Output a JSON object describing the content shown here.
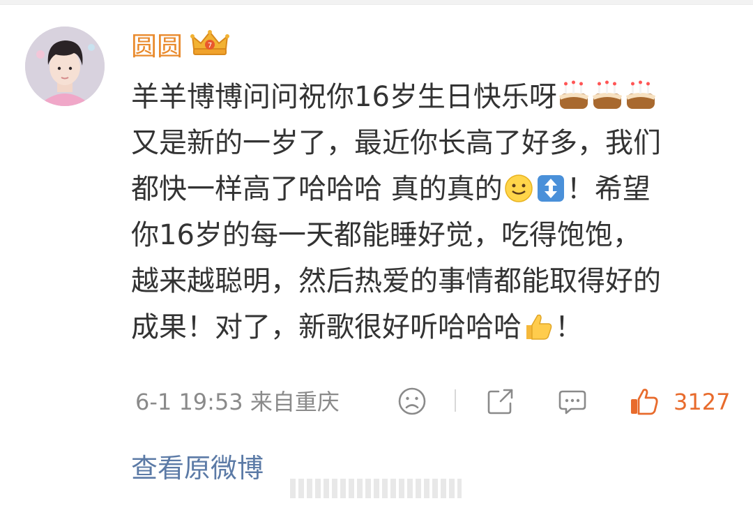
{
  "post": {
    "username": "圆圆",
    "badge_icon": "crown-badge-icon",
    "comment_lines": [
      "羊羊博博问问祝你16岁生日快乐呀",
      "又是新的一岁了，最近你长高了好多，我们",
      "都快一样高了哈哈哈 真的真的",
      "你16岁的每一天都能睡好觉，吃得饱饱，",
      "越来越聪明，然后热爱的事情都能取得好的",
      "成果！对了，新歌很好听哈哈哈"
    ],
    "line3_tail": "！希望",
    "line6_tail": "！",
    "timestamp": "6-1 19:53",
    "location": "来自重庆",
    "likes": "3127",
    "view_original_link": "查看原微博"
  },
  "colors": {
    "username": "#e98a2c",
    "text": "#333333",
    "meta": "#8a8a8a",
    "like": "#e86b2c",
    "link": "#5b7aa6"
  }
}
